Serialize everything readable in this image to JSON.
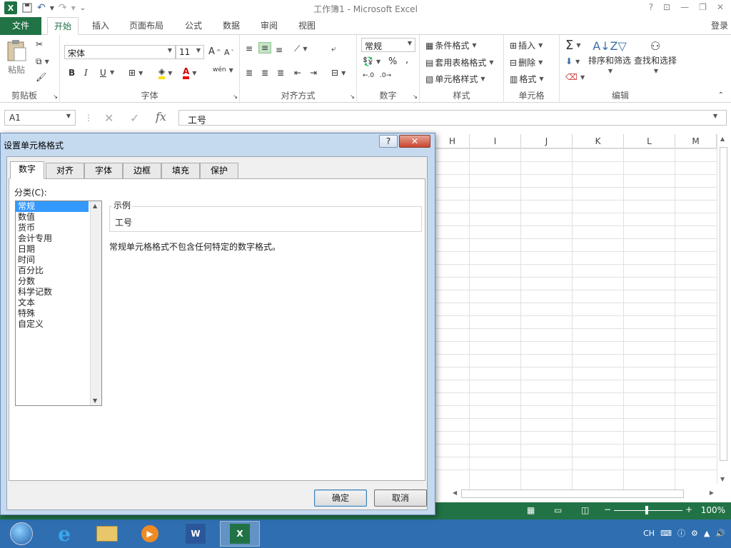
{
  "app": {
    "title": "工作簿1 - Microsoft Excel",
    "login": "登录",
    "accent": "#217346"
  },
  "tabs": [
    {
      "label": "文件"
    },
    {
      "label": "开始"
    },
    {
      "label": "插入"
    },
    {
      "label": "页面布局"
    },
    {
      "label": "公式"
    },
    {
      "label": "数据"
    },
    {
      "label": "审阅"
    },
    {
      "label": "视图"
    }
  ],
  "ribbon": {
    "clipboard": {
      "label": "剪贴板",
      "paste": "粘贴"
    },
    "font": {
      "label": "字体",
      "name": "宋体",
      "size": "11",
      "bold": "B",
      "italic": "I",
      "underline": "U",
      "wen": "wén"
    },
    "alignment": {
      "label": "对齐方式"
    },
    "number": {
      "label": "数字",
      "format": "常规",
      "percent": "%"
    },
    "styles": {
      "label": "样式",
      "conditional": "条件格式",
      "table": "套用表格格式",
      "cell": "单元格样式"
    },
    "cells": {
      "label": "单元格",
      "insert": "插入",
      "delete": "删除",
      "format": "格式"
    },
    "editing": {
      "label": "编辑",
      "sort": "排序和筛选",
      "find": "查找和选择"
    }
  },
  "formula_bar": {
    "name_box": "A1",
    "content": "工号"
  },
  "columns": [
    "H",
    "I",
    "J",
    "K",
    "L",
    "M"
  ],
  "status": {
    "zoom": "100%"
  },
  "taskbar": {
    "lang": "CH"
  },
  "dialog": {
    "title": "设置单元格格式",
    "help": "?",
    "close": "✕",
    "tabs": [
      "数字",
      "对齐",
      "字体",
      "边框",
      "填充",
      "保护"
    ],
    "category_label": "分类(C):",
    "categories": [
      "常规",
      "数值",
      "货币",
      "会计专用",
      "日期",
      "时间",
      "百分比",
      "分数",
      "科学记数",
      "文本",
      "特殊",
      "自定义"
    ],
    "selected_category": "常规",
    "sample_label": "示例",
    "sample_value": "工号",
    "description": "常规单元格格式不包含任何特定的数字格式。",
    "ok": "确定",
    "cancel": "取消"
  }
}
